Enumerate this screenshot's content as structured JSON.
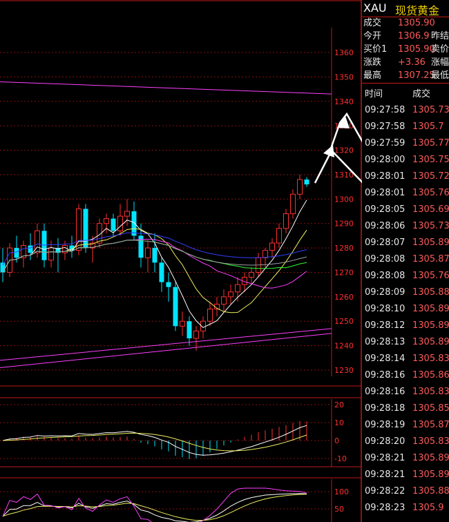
{
  "chart_data": {
    "type": "candlestick",
    "price_ticks": [
      "1360",
      "1350",
      "1340",
      "1330",
      "1320",
      "1310",
      "1300",
      "1290",
      "1280",
      "1270",
      "1260",
      "1250",
      "1240",
      "1230"
    ],
    "macd_ticks": [
      "20",
      "10",
      "0",
      "-10"
    ],
    "kdj_ticks": [
      "100",
      "50"
    ],
    "candles": [
      {
        "o": 1274,
        "h": 1280,
        "l": 1266,
        "c": 1270
      },
      {
        "o": 1270,
        "h": 1282,
        "l": 1268,
        "c": 1280
      },
      {
        "o": 1280,
        "h": 1285,
        "l": 1274,
        "c": 1276
      },
      {
        "o": 1276,
        "h": 1283,
        "l": 1272,
        "c": 1281
      },
      {
        "o": 1281,
        "h": 1286,
        "l": 1275,
        "c": 1278
      },
      {
        "o": 1278,
        "h": 1290,
        "l": 1276,
        "c": 1287
      },
      {
        "o": 1287,
        "h": 1290,
        "l": 1272,
        "c": 1275
      },
      {
        "o": 1275,
        "h": 1283,
        "l": 1272,
        "c": 1280
      },
      {
        "o": 1280,
        "h": 1284,
        "l": 1270,
        "c": 1278
      },
      {
        "o": 1278,
        "h": 1283,
        "l": 1275,
        "c": 1281
      },
      {
        "o": 1281,
        "h": 1285,
        "l": 1276,
        "c": 1279
      },
      {
        "o": 1279,
        "h": 1298,
        "l": 1277,
        "c": 1296
      },
      {
        "o": 1296,
        "h": 1298,
        "l": 1278,
        "c": 1280
      },
      {
        "o": 1280,
        "h": 1285,
        "l": 1274,
        "c": 1282
      },
      {
        "o": 1282,
        "h": 1292,
        "l": 1280,
        "c": 1290
      },
      {
        "o": 1290,
        "h": 1294,
        "l": 1286,
        "c": 1292
      },
      {
        "o": 1292,
        "h": 1294,
        "l": 1285,
        "c": 1287
      },
      {
        "o": 1287,
        "h": 1298,
        "l": 1285,
        "c": 1293
      },
      {
        "o": 1293,
        "h": 1300,
        "l": 1289,
        "c": 1295
      },
      {
        "o": 1295,
        "h": 1299,
        "l": 1283,
        "c": 1285
      },
      {
        "o": 1285,
        "h": 1290,
        "l": 1272,
        "c": 1276
      },
      {
        "o": 1276,
        "h": 1283,
        "l": 1270,
        "c": 1280
      },
      {
        "o": 1280,
        "h": 1286,
        "l": 1270,
        "c": 1274
      },
      {
        "o": 1274,
        "h": 1276,
        "l": 1262,
        "c": 1266
      },
      {
        "o": 1266,
        "h": 1270,
        "l": 1258,
        "c": 1264
      },
      {
        "o": 1264,
        "h": 1266,
        "l": 1246,
        "c": 1248
      },
      {
        "o": 1248,
        "h": 1254,
        "l": 1244,
        "c": 1250
      },
      {
        "o": 1250,
        "h": 1252,
        "l": 1240,
        "c": 1243
      },
      {
        "o": 1243,
        "h": 1248,
        "l": 1238,
        "c": 1246
      },
      {
        "o": 1246,
        "h": 1252,
        "l": 1243,
        "c": 1250
      },
      {
        "o": 1250,
        "h": 1258,
        "l": 1248,
        "c": 1255
      },
      {
        "o": 1255,
        "h": 1260,
        "l": 1252,
        "c": 1257
      },
      {
        "o": 1257,
        "h": 1263,
        "l": 1254,
        "c": 1260
      },
      {
        "o": 1260,
        "h": 1265,
        "l": 1257,
        "c": 1262
      },
      {
        "o": 1262,
        "h": 1268,
        "l": 1258,
        "c": 1265
      },
      {
        "o": 1265,
        "h": 1270,
        "l": 1262,
        "c": 1268
      },
      {
        "o": 1268,
        "h": 1272,
        "l": 1265,
        "c": 1270
      },
      {
        "o": 1270,
        "h": 1278,
        "l": 1268,
        "c": 1276
      },
      {
        "o": 1276,
        "h": 1280,
        "l": 1272,
        "c": 1279
      },
      {
        "o": 1279,
        "h": 1284,
        "l": 1276,
        "c": 1282
      },
      {
        "o": 1282,
        "h": 1290,
        "l": 1280,
        "c": 1288
      },
      {
        "o": 1288,
        "h": 1296,
        "l": 1286,
        "c": 1294
      },
      {
        "o": 1294,
        "h": 1304,
        "l": 1292,
        "c": 1302
      },
      {
        "o": 1302,
        "h": 1310,
        "l": 1300,
        "c": 1308
      },
      {
        "o": 1308,
        "h": 1309,
        "l": 1305,
        "c": 1306
      }
    ]
  },
  "quote": {
    "symbol": "XAU",
    "name": "现货黄金",
    "rows": [
      {
        "label": "成交",
        "value": "1305.90",
        "extra": ""
      },
      {
        "label": "今开",
        "value": "1306.9",
        "extra": "昨结"
      },
      {
        "label": "买价1",
        "value": "1305.90",
        "extra": "卖价"
      },
      {
        "label": "涨跌",
        "value": "+3.36",
        "extra": "涨幅"
      },
      {
        "label": "最高",
        "value": "1307.25",
        "extra": "最低"
      }
    ]
  },
  "ticks": {
    "headers": {
      "time": "时间",
      "price": "成交"
    },
    "rows": [
      {
        "time": "09:27:58",
        "price": "1305.73"
      },
      {
        "time": "09:27:58",
        "price": "1305.7"
      },
      {
        "time": "09:27:59",
        "price": "1305.77"
      },
      {
        "time": "09:28:00",
        "price": "1305.75"
      },
      {
        "time": "09:28:01",
        "price": "1305.72"
      },
      {
        "time": "09:28:01",
        "price": "1305.76"
      },
      {
        "time": "09:28:05",
        "price": "1305.69"
      },
      {
        "time": "09:28:06",
        "price": "1305.73"
      },
      {
        "time": "09:28:07",
        "price": "1305.89"
      },
      {
        "time": "09:28:08",
        "price": "1305.87"
      },
      {
        "time": "09:28:08",
        "price": "1305.76"
      },
      {
        "time": "09:28:09",
        "price": "1305.88"
      },
      {
        "time": "09:28:10",
        "price": "1305.89"
      },
      {
        "time": "09:28:12",
        "price": "1305.89"
      },
      {
        "time": "09:28:13",
        "price": "1305.89"
      },
      {
        "time": "09:28:14",
        "price": "1305.83"
      },
      {
        "time": "09:28:16",
        "price": "1305.86"
      },
      {
        "time": "09:28:16",
        "price": "1305.83"
      },
      {
        "time": "09:28:18",
        "price": "1305.85"
      },
      {
        "time": "09:28:19",
        "price": "1305.87"
      },
      {
        "time": "09:28:20",
        "price": "1305.83"
      },
      {
        "time": "09:28:21",
        "price": "1305.89"
      },
      {
        "time": "09:28:21",
        "price": "1305.89"
      },
      {
        "time": "09:28:22",
        "price": "1305.88"
      },
      {
        "time": "09:28:23",
        "price": "1305.9"
      }
    ]
  },
  "colors": {
    "up": "#ff3030",
    "down": "#00e5ff",
    "grid": "#8a1010",
    "frame": "#c01818",
    "ma_white": "#ffffff",
    "ma_yellow": "#f0f060",
    "ma_magenta": "#ff40ff",
    "ma_green": "#30ff30",
    "ma_blue": "#3040ff",
    "ma_gray": "#a0a0a0",
    "arrow": "#ffffff",
    "price_text": "#ff5a5a",
    "label_text": "#e8e8e8",
    "title_name": "#f0d000"
  }
}
